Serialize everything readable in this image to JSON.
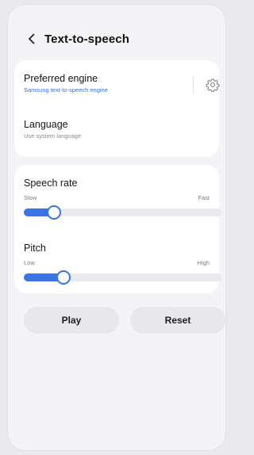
{
  "header": {
    "title": "Text-to-speech",
    "back_icon": "chevron-left-icon"
  },
  "engine": {
    "title": "Preferred engine",
    "value": "Samsung text-to-speech engine",
    "settings_icon": "gear-icon"
  },
  "language": {
    "title": "Language",
    "value": "Use system language"
  },
  "speech_rate": {
    "title": "Speech rate",
    "min_label": "Slow",
    "max_label": "Fast",
    "value_fraction": 0.15
  },
  "pitch": {
    "title": "Pitch",
    "min_label": "Low",
    "max_label": "High",
    "value_fraction": 0.2
  },
  "buttons": {
    "play": "Play",
    "reset": "Reset"
  },
  "colors": {
    "accent": "#3a73e6",
    "link": "#3e6fd8",
    "background": "#f4f4f6",
    "card": "#ffffff"
  }
}
